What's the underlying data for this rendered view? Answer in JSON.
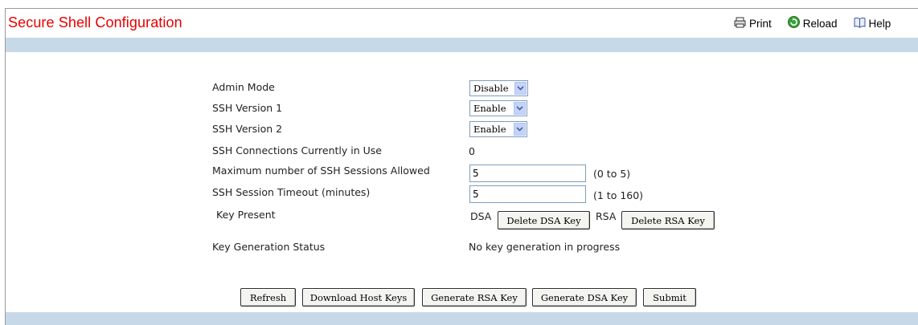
{
  "header": {
    "title": "Secure Shell Configuration",
    "print_label": "Print",
    "reload_label": "Reload",
    "help_label": "Help"
  },
  "form": {
    "admin_mode": {
      "label": "Admin Mode",
      "value": "Disable"
    },
    "ssh_v1": {
      "label": "SSH Version 1",
      "value": "Enable"
    },
    "ssh_v2": {
      "label": "SSH Version 2",
      "value": "Enable"
    },
    "connections": {
      "label": "SSH Connections Currently in Use",
      "value": "0"
    },
    "max_sessions": {
      "label": "Maximum number of SSH Sessions Allowed",
      "value": "5",
      "range": "(0 to 5)"
    },
    "timeout": {
      "label": "SSH Session Timeout (minutes)",
      "value": "5",
      "range": "(1 to 160)"
    },
    "key_present": {
      "label": "Key Present",
      "dsa_label": "DSA",
      "dsa_button": "Delete DSA Key",
      "rsa_label": "RSA",
      "rsa_button": "Delete RSA Key"
    },
    "keygen_status": {
      "label": "Key Generation Status",
      "value": "No key generation in progress"
    }
  },
  "actions": {
    "refresh": "Refresh",
    "download": "Download Host Keys",
    "gen_rsa": "Generate RSA Key",
    "gen_dsa": "Generate DSA Key",
    "submit": "Submit"
  },
  "colors": {
    "title": "#e60000",
    "band": "#c7d9e8"
  },
  "icons": {
    "print": "printer-icon",
    "reload": "reload-icon",
    "help": "help-book-icon",
    "dropdown": "chevron-down-icon"
  }
}
